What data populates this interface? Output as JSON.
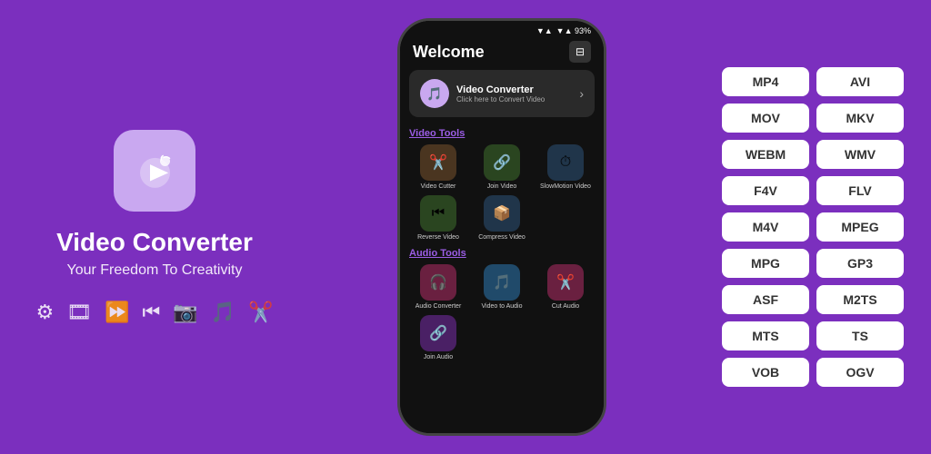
{
  "app": {
    "title": "Video Converter",
    "subtitle": "Your Freedom To Creativity",
    "icon_emoji": "▶",
    "status_bar": "▼▲ 93%"
  },
  "phone": {
    "header_title": "Welcome",
    "banner": {
      "title": "Video Converter",
      "subtitle": "Click here to Convert Video",
      "icon": "🎵"
    },
    "video_tools_label": "Video Tools",
    "video_tools": [
      {
        "label": "Video Cutter",
        "color": "#4a3520",
        "emoji": "✂️"
      },
      {
        "label": "Join Video",
        "color": "#2a3520",
        "emoji": "🔗"
      },
      {
        "label": "SlowMotion Video",
        "color": "#20354a",
        "emoji": "⏱"
      },
      {
        "label": "Reverse Video",
        "color": "#2a3520",
        "emoji": "⏮"
      },
      {
        "label": "Compress Video",
        "color": "#20354a",
        "emoji": "📦"
      }
    ],
    "audio_tools_label": "Audio Tools",
    "audio_tools": [
      {
        "label": "Audio Converter",
        "color": "#4a2035",
        "emoji": "🎧"
      },
      {
        "label": "Video to Audio",
        "color": "#20354a",
        "emoji": "🎵"
      },
      {
        "label": "Cut Audio",
        "color": "#4a2035",
        "emoji": "✂️"
      },
      {
        "label": "Join Audio",
        "color": "#3a2045",
        "emoji": "🔗"
      }
    ]
  },
  "formats": [
    "MP4",
    "AVI",
    "MOV",
    "MKV",
    "WEBM",
    "WMV",
    "F4V",
    "FLV",
    "M4V",
    "MPEG",
    "MPG",
    "GP3",
    "ASF",
    "M2TS",
    "MTS",
    "TS",
    "VOB",
    "OGV"
  ],
  "feature_icons": [
    "⚙",
    "🎞",
    "⏩",
    "⏮",
    "📷",
    "🎵",
    "✂️"
  ]
}
